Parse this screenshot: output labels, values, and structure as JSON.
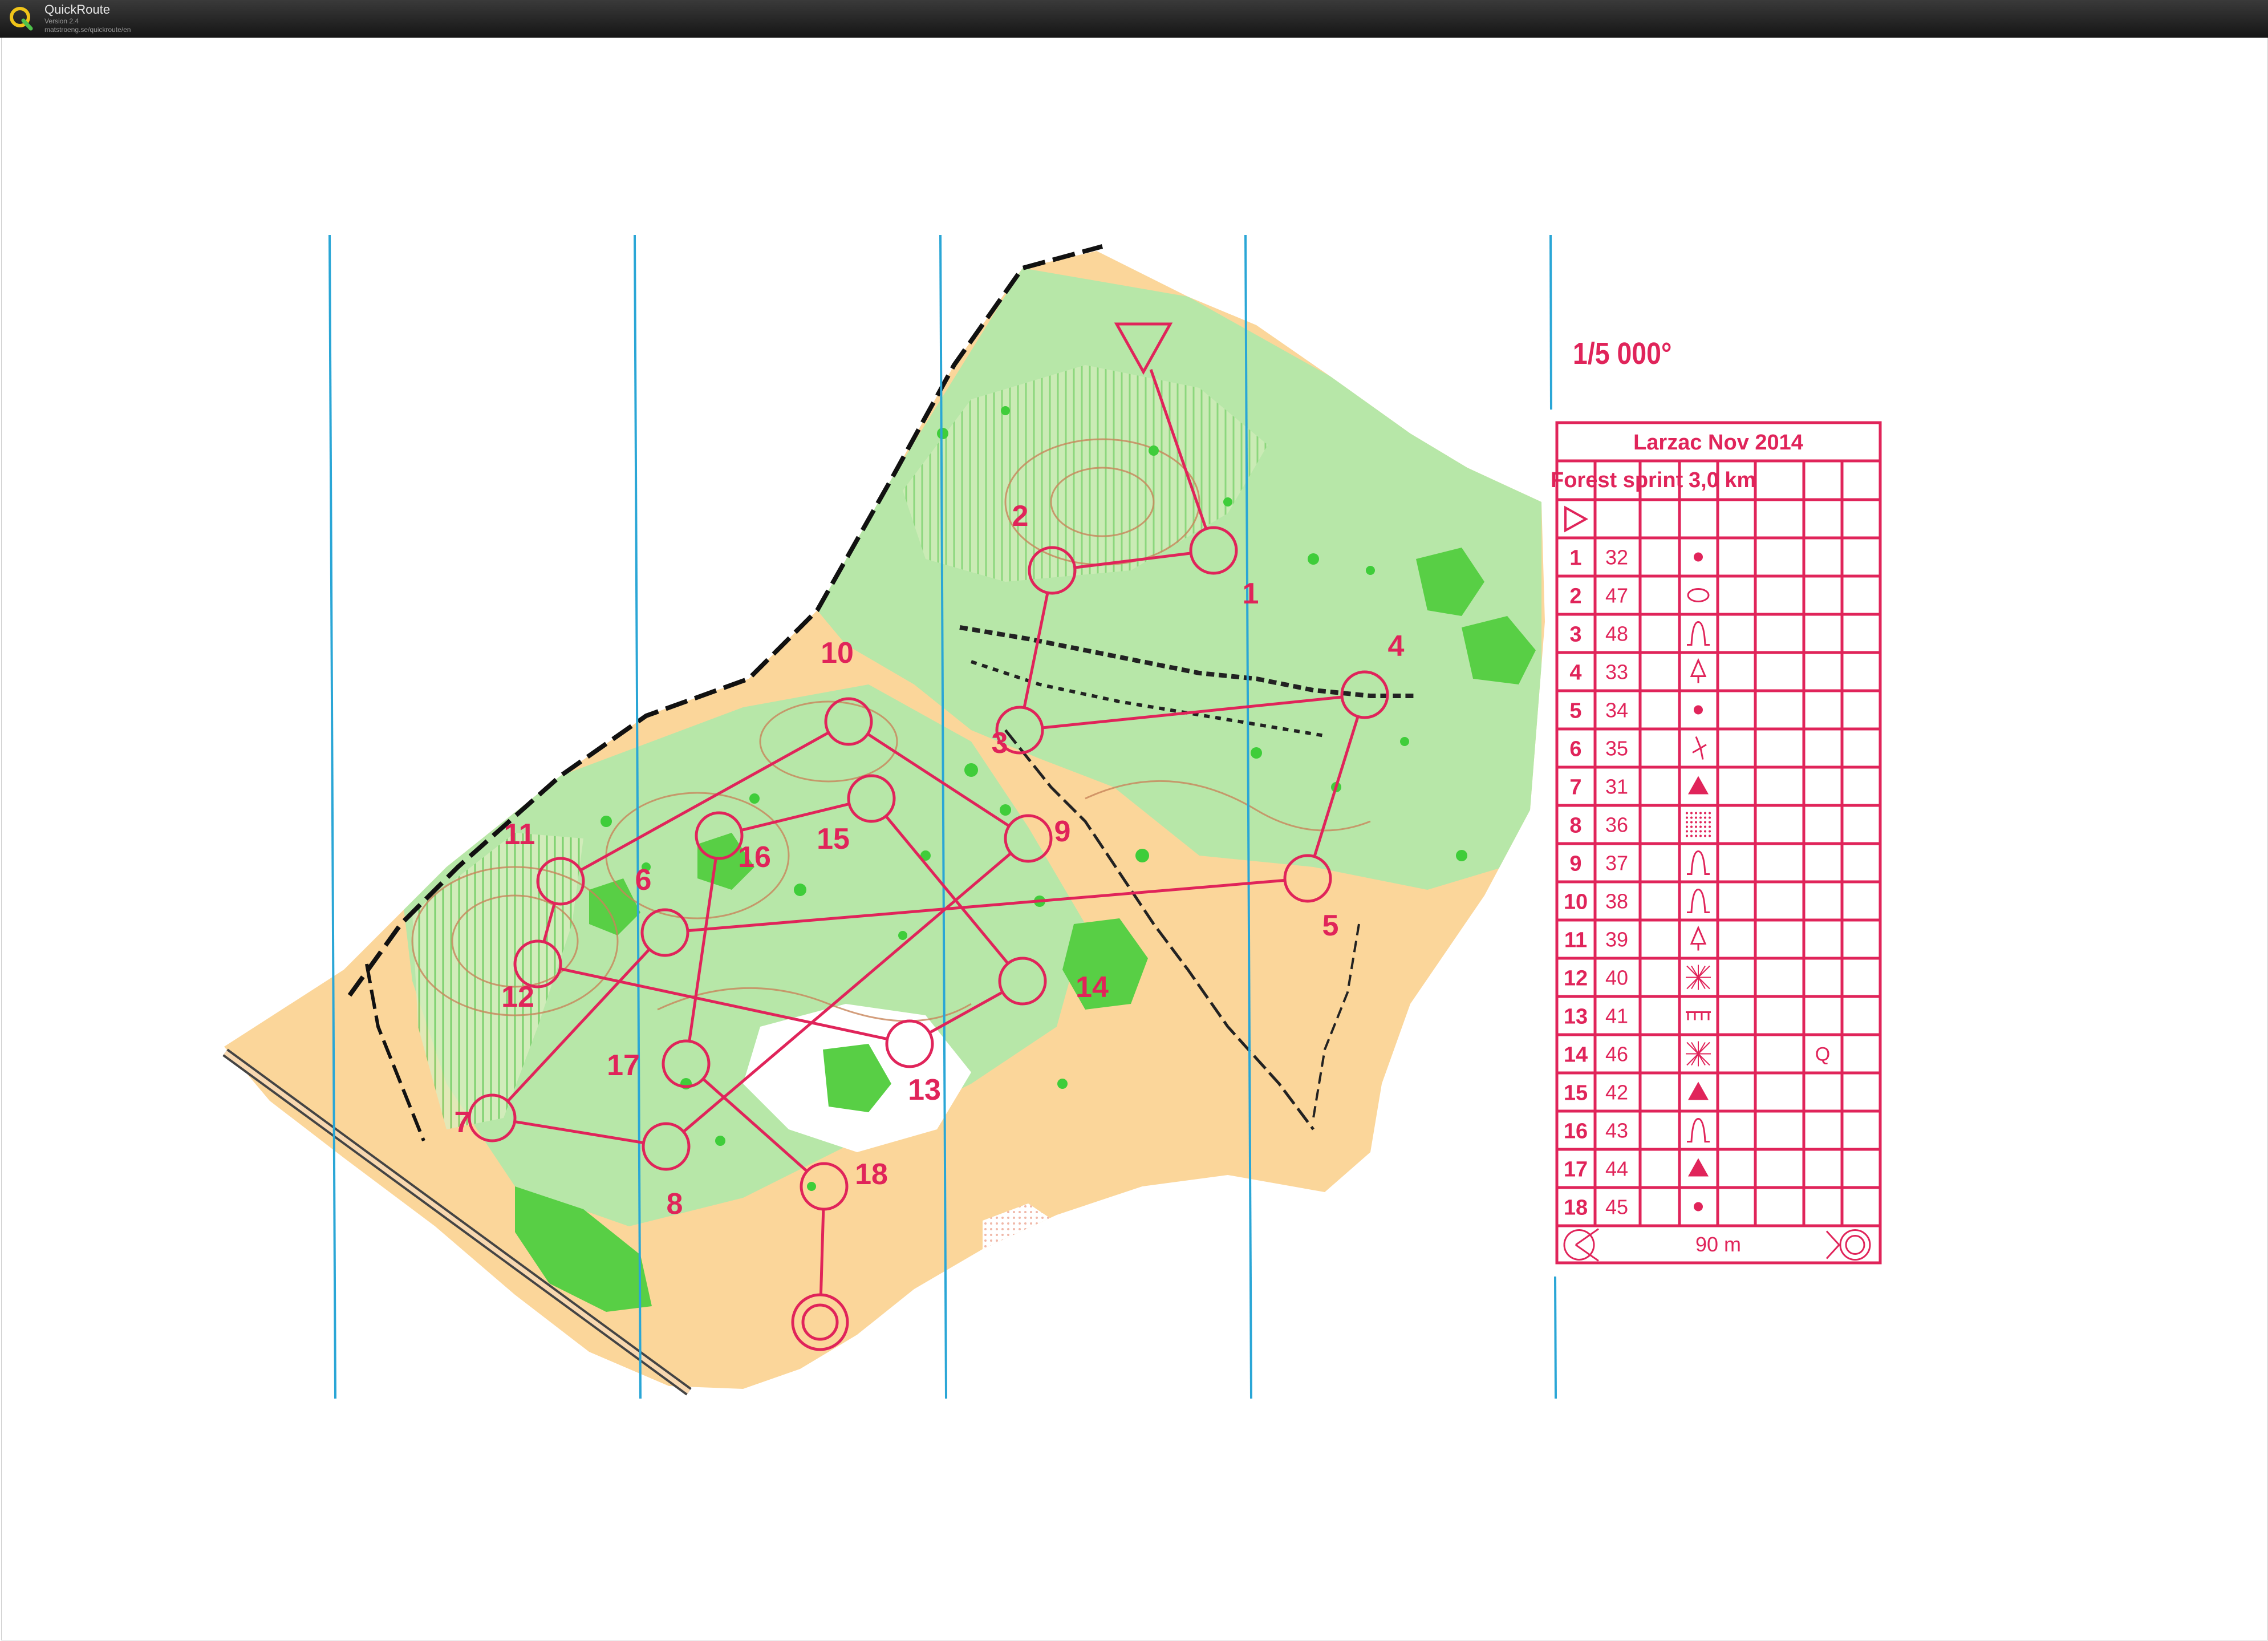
{
  "app": {
    "title": "QuickRoute",
    "version": "Version 2.4",
    "url": "matstroeng.se/quickroute/en"
  },
  "colors": {
    "course": "#e0245a",
    "meridian": "#2aa6d6",
    "open_land": "#fbd69a",
    "forest_green": "#4fd24a",
    "light_green": "#a8e6a0"
  },
  "map": {
    "scale": "1/5 000°",
    "course_title": "Larzac Nov 2014",
    "course_class": "Forest sprint",
    "course_length": "3,0 km",
    "finish_distance": "90 m",
    "start_symbol": "start-triangle-icon",
    "finish_symbol": "finish-circle-icon",
    "controls": [
      {
        "n": "1"
      },
      {
        "n": "2"
      },
      {
        "n": "3"
      },
      {
        "n": "4"
      },
      {
        "n": "5"
      },
      {
        "n": "6"
      },
      {
        "n": "7"
      },
      {
        "n": "8"
      },
      {
        "n": "9"
      },
      {
        "n": "10"
      },
      {
        "n": "11"
      },
      {
        "n": "12"
      },
      {
        "n": "13"
      },
      {
        "n": "14"
      },
      {
        "n": "15"
      },
      {
        "n": "16"
      },
      {
        "n": "17"
      },
      {
        "n": "18"
      }
    ]
  },
  "descriptions": [
    {
      "n": "1",
      "code": "32",
      "symbol": "dot-icon",
      "extra": ""
    },
    {
      "n": "2",
      "code": "47",
      "symbol": "ellipse-icon",
      "extra": ""
    },
    {
      "n": "3",
      "code": "48",
      "symbol": "knoll-icon",
      "extra": ""
    },
    {
      "n": "4",
      "code": "33",
      "symbol": "tree-icon",
      "extra": ""
    },
    {
      "n": "5",
      "code": "34",
      "symbol": "dot-icon",
      "extra": ""
    },
    {
      "n": "6",
      "code": "35",
      "symbol": "root-stock-icon",
      "extra": ""
    },
    {
      "n": "7",
      "code": "31",
      "symbol": "triangle-filled-icon",
      "extra": ""
    },
    {
      "n": "8",
      "code": "36",
      "symbol": "dotted-square-icon",
      "extra": ""
    },
    {
      "n": "9",
      "code": "37",
      "symbol": "knoll-icon",
      "extra": ""
    },
    {
      "n": "10",
      "code": "38",
      "symbol": "knoll-icon",
      "extra": ""
    },
    {
      "n": "11",
      "code": "39",
      "symbol": "tree-icon",
      "extra": ""
    },
    {
      "n": "12",
      "code": "40",
      "symbol": "thicket-icon",
      "extra": ""
    },
    {
      "n": "13",
      "code": "41",
      "symbol": "fence-icon",
      "extra": ""
    },
    {
      "n": "14",
      "code": "46",
      "symbol": "thicket-icon",
      "extra": "Q"
    },
    {
      "n": "15",
      "code": "42",
      "symbol": "triangle-filled-icon",
      "extra": ""
    },
    {
      "n": "16",
      "code": "43",
      "symbol": "knoll-icon",
      "extra": ""
    },
    {
      "n": "17",
      "code": "44",
      "symbol": "triangle-filled-icon",
      "extra": ""
    },
    {
      "n": "18",
      "code": "45",
      "symbol": "dot-icon",
      "extra": ""
    }
  ]
}
